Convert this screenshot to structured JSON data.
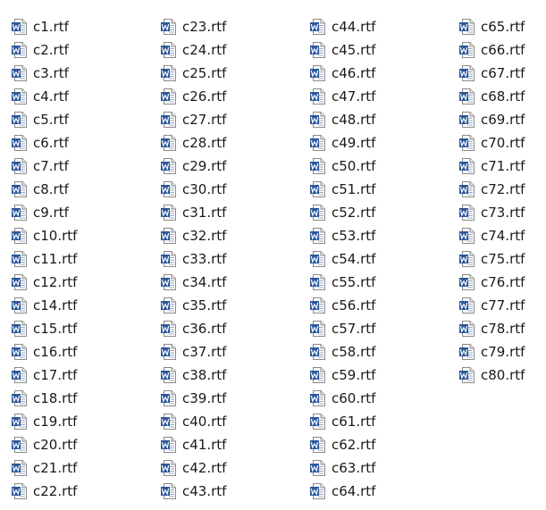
{
  "icon": "word-document-icon",
  "accent_color": "#2b579a",
  "columns": [
    [
      "c1.rtf",
      "c2.rtf",
      "c3.rtf",
      "c4.rtf",
      "c5.rtf",
      "c6.rtf",
      "c7.rtf",
      "c8.rtf",
      "c9.rtf",
      "c10.rtf",
      "c11.rtf",
      "c12.rtf",
      "c14.rtf",
      "c15.rtf",
      "c16.rtf",
      "c17.rtf",
      "c18.rtf",
      "c19.rtf",
      "c20.rtf",
      "c21.rtf",
      "c22.rtf"
    ],
    [
      "c23.rtf",
      "c24.rtf",
      "c25.rtf",
      "c26.rtf",
      "c27.rtf",
      "c28.rtf",
      "c29.rtf",
      "c30.rtf",
      "c31.rtf",
      "c32.rtf",
      "c33.rtf",
      "c34.rtf",
      "c35.rtf",
      "c36.rtf",
      "c37.rtf",
      "c38.rtf",
      "c39.rtf",
      "c40.rtf",
      "c41.rtf",
      "c42.rtf",
      "c43.rtf"
    ],
    [
      "c44.rtf",
      "c45.rtf",
      "c46.rtf",
      "c47.rtf",
      "c48.rtf",
      "c49.rtf",
      "c50.rtf",
      "c51.rtf",
      "c52.rtf",
      "c53.rtf",
      "c54.rtf",
      "c55.rtf",
      "c56.rtf",
      "c57.rtf",
      "c58.rtf",
      "c59.rtf",
      "c60.rtf",
      "c61.rtf",
      "c62.rtf",
      "c63.rtf",
      "c64.rtf"
    ],
    [
      "c65.rtf",
      "c66.rtf",
      "c67.rtf",
      "c68.rtf",
      "c69.rtf",
      "c70.rtf",
      "c71.rtf",
      "c72.rtf",
      "c73.rtf",
      "c74.rtf",
      "c75.rtf",
      "c76.rtf",
      "c77.rtf",
      "c78.rtf",
      "c79.rtf",
      "c80.rtf"
    ]
  ]
}
